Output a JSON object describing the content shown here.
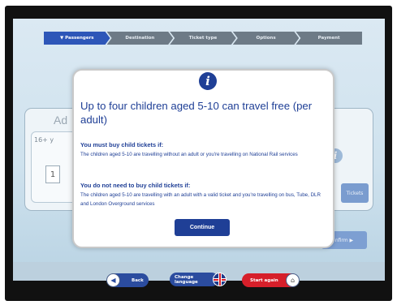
{
  "steps": [
    {
      "label": "▼ Passengers"
    },
    {
      "label": "Destination"
    },
    {
      "label": "Ticket type"
    },
    {
      "label": "Options"
    },
    {
      "label": "Payment"
    }
  ],
  "background": {
    "panel_title": "Ad",
    "age_label": "16+ y",
    "count_value": "1",
    "tickets_label": "Tickets",
    "confirm_label": "nfirm ▶",
    "info_glyph": "i"
  },
  "modal": {
    "icon_glyph": "i",
    "title": "Up to four children aged 5-10 can travel free (per adult)",
    "must_head": "You must buy child tickets if:",
    "must_body": "The children aged 5-10 are travelling without an adult or you're travelling on National Rail services",
    "not_head": "You do not need to buy child tickets if:",
    "not_body": "The children aged 5-10 are travelling with an adult with a valid ticket and you're travelling on bus, Tube, DLR and London Overground services",
    "continue_label": "Continue"
  },
  "nav": {
    "back_label": "Back",
    "lang_line1": "Change",
    "lang_line2": "language",
    "start_label": "Start again"
  },
  "colors": {
    "accent": "#1f3f96",
    "active_step": "#2d56b8",
    "start_again": "#d61f2a"
  }
}
